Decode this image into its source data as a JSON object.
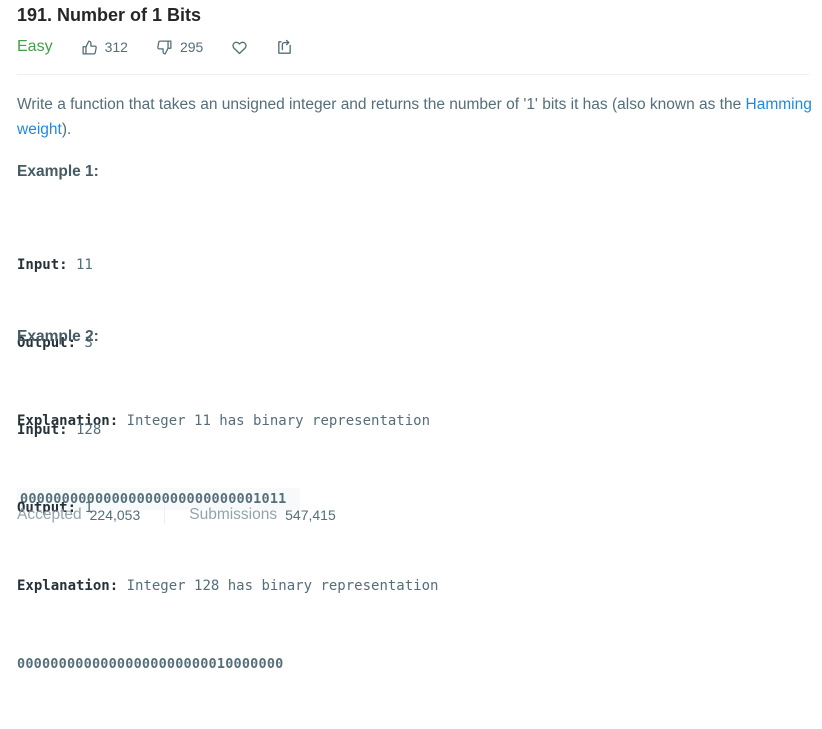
{
  "problem": {
    "title": "191. Number of 1 Bits",
    "difficulty": "Easy",
    "likes": "312",
    "dislikes": "295"
  },
  "description": {
    "text_before": "Write a function that takes an unsigned integer and returns the number of '1' bits it has (also known as the ",
    "link": "Hamming weight",
    "text_after": ")."
  },
  "examples": [
    {
      "title": "Example 1:",
      "input_label": "Input:",
      "input_value": " 11",
      "output_label": "Output:",
      "output_value": " 3",
      "explanation_label": "Explanation:",
      "explanation_text": " Integer 11 has binary representation",
      "binary": "00000000000000000000000000001011"
    },
    {
      "title": "Example 2:",
      "input_label": "Input:",
      "input_value": " 128",
      "output_label": "Output:",
      "output_value": " 1",
      "explanation_label": "Explanation:",
      "explanation_text": " Integer 128 has binary representation",
      "binary": "00000000000000000000000010000000"
    }
  ],
  "stats": {
    "accepted_label": "Accepted",
    "accepted_value": "224,053",
    "submissions_label": "Submissions",
    "submissions_value": "547,415"
  },
  "colors": {
    "difficulty_easy": "#43a047",
    "link": "#1e88e5",
    "muted_text": "#546e7a"
  },
  "icons": [
    "thumbs-up-icon",
    "thumbs-down-icon",
    "heart-icon",
    "share-icon"
  ]
}
